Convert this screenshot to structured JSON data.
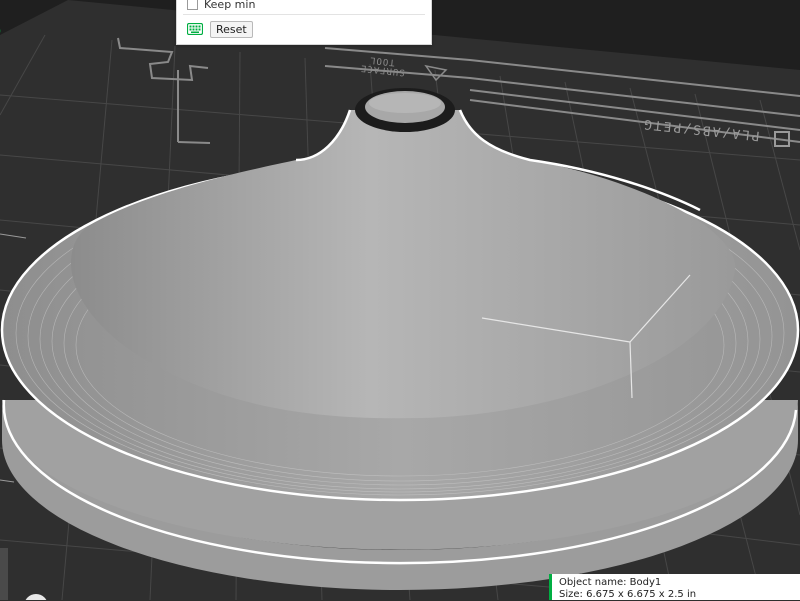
{
  "theme": {
    "accent": "#00ae42",
    "plate": "#2f2f2f",
    "grid": "#4a4a4a",
    "model": "#a9a9a9",
    "outline": "#ffffff"
  },
  "plate": {
    "marking_1": "PLA/ABS/PETG",
    "marking_2": "SURFACE",
    "marking_3": "TOOL"
  },
  "panel": {
    "keep_min_label": "Keep min",
    "keep_min_checked": false,
    "reset_label": "Reset",
    "reset_icon": "keyboard-icon"
  },
  "object_info": {
    "name": "Object name: Body1",
    "size": "Size: 6.675 x 6.675 x 2.5 in"
  }
}
